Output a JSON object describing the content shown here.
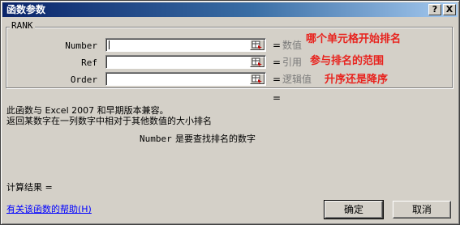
{
  "dialog": {
    "title": "函数参数",
    "help_button": "?",
    "close_button": "X"
  },
  "function_group": {
    "name": "RANK",
    "arguments": [
      {
        "label": "Number",
        "value": "",
        "eq": "=",
        "hint": "数值",
        "annotation": "哪个单元格开始排名"
      },
      {
        "label": "Ref",
        "value": "",
        "eq": "=",
        "hint": "引用",
        "annotation": "参与排名的范围"
      },
      {
        "label": "Order",
        "value": "",
        "eq": "=",
        "hint": "逻辑值",
        "annotation": "升序还是降序"
      }
    ]
  },
  "result_eq": "=",
  "description": {
    "compat": "此函数与 Excel 2007 和早期版本兼容。",
    "summary": "返回某数字在一列数字中相对于其他数值的大小排名",
    "arg_name": "Number",
    "arg_help": "是要查找排名的数字"
  },
  "result_label": "计算结果 =",
  "help_link": "有关该函数的帮助(H)",
  "ok_button": "确定",
  "cancel_button": "取消",
  "colors": {
    "annotation": "#e8231e",
    "title_start": "#0a246a",
    "title_end": "#a6caf0",
    "face": "#d4d0c8"
  }
}
